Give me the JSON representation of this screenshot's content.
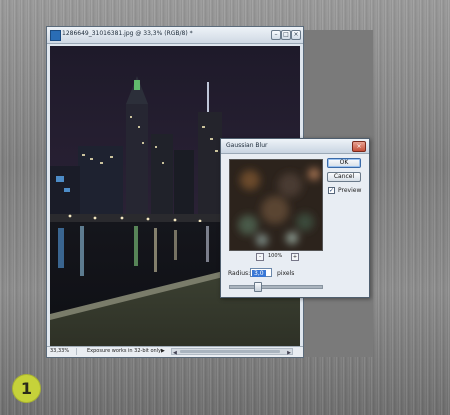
{
  "document": {
    "title": "1286649_31016381.jpg @ 33,3% (RGB/8) *",
    "min_symbol": "–",
    "max_symbol": "□",
    "close_symbol": "×",
    "zoom": "33,33%",
    "status": "Exposure works in 32-bit only",
    "status_arrow": "▶",
    "scroll_left": "◀",
    "scroll_right": "▶"
  },
  "dialog": {
    "title": "Gaussian Blur",
    "close_symbol": "×",
    "ok_label": "OK",
    "cancel_label": "Cancel",
    "preview_label": "Preview",
    "preview_checked": "✓",
    "zoom_out": "-",
    "zoom_in": "+",
    "zoom_percent": "100%",
    "radius_label": "Radius:",
    "radius_value": "3,0",
    "radius_unit": "pixels",
    "radius_slider_fraction": 0.3
  },
  "step_badge": "1",
  "colors": {
    "badge": "#c6d23a",
    "selection": "#3a78d6"
  }
}
